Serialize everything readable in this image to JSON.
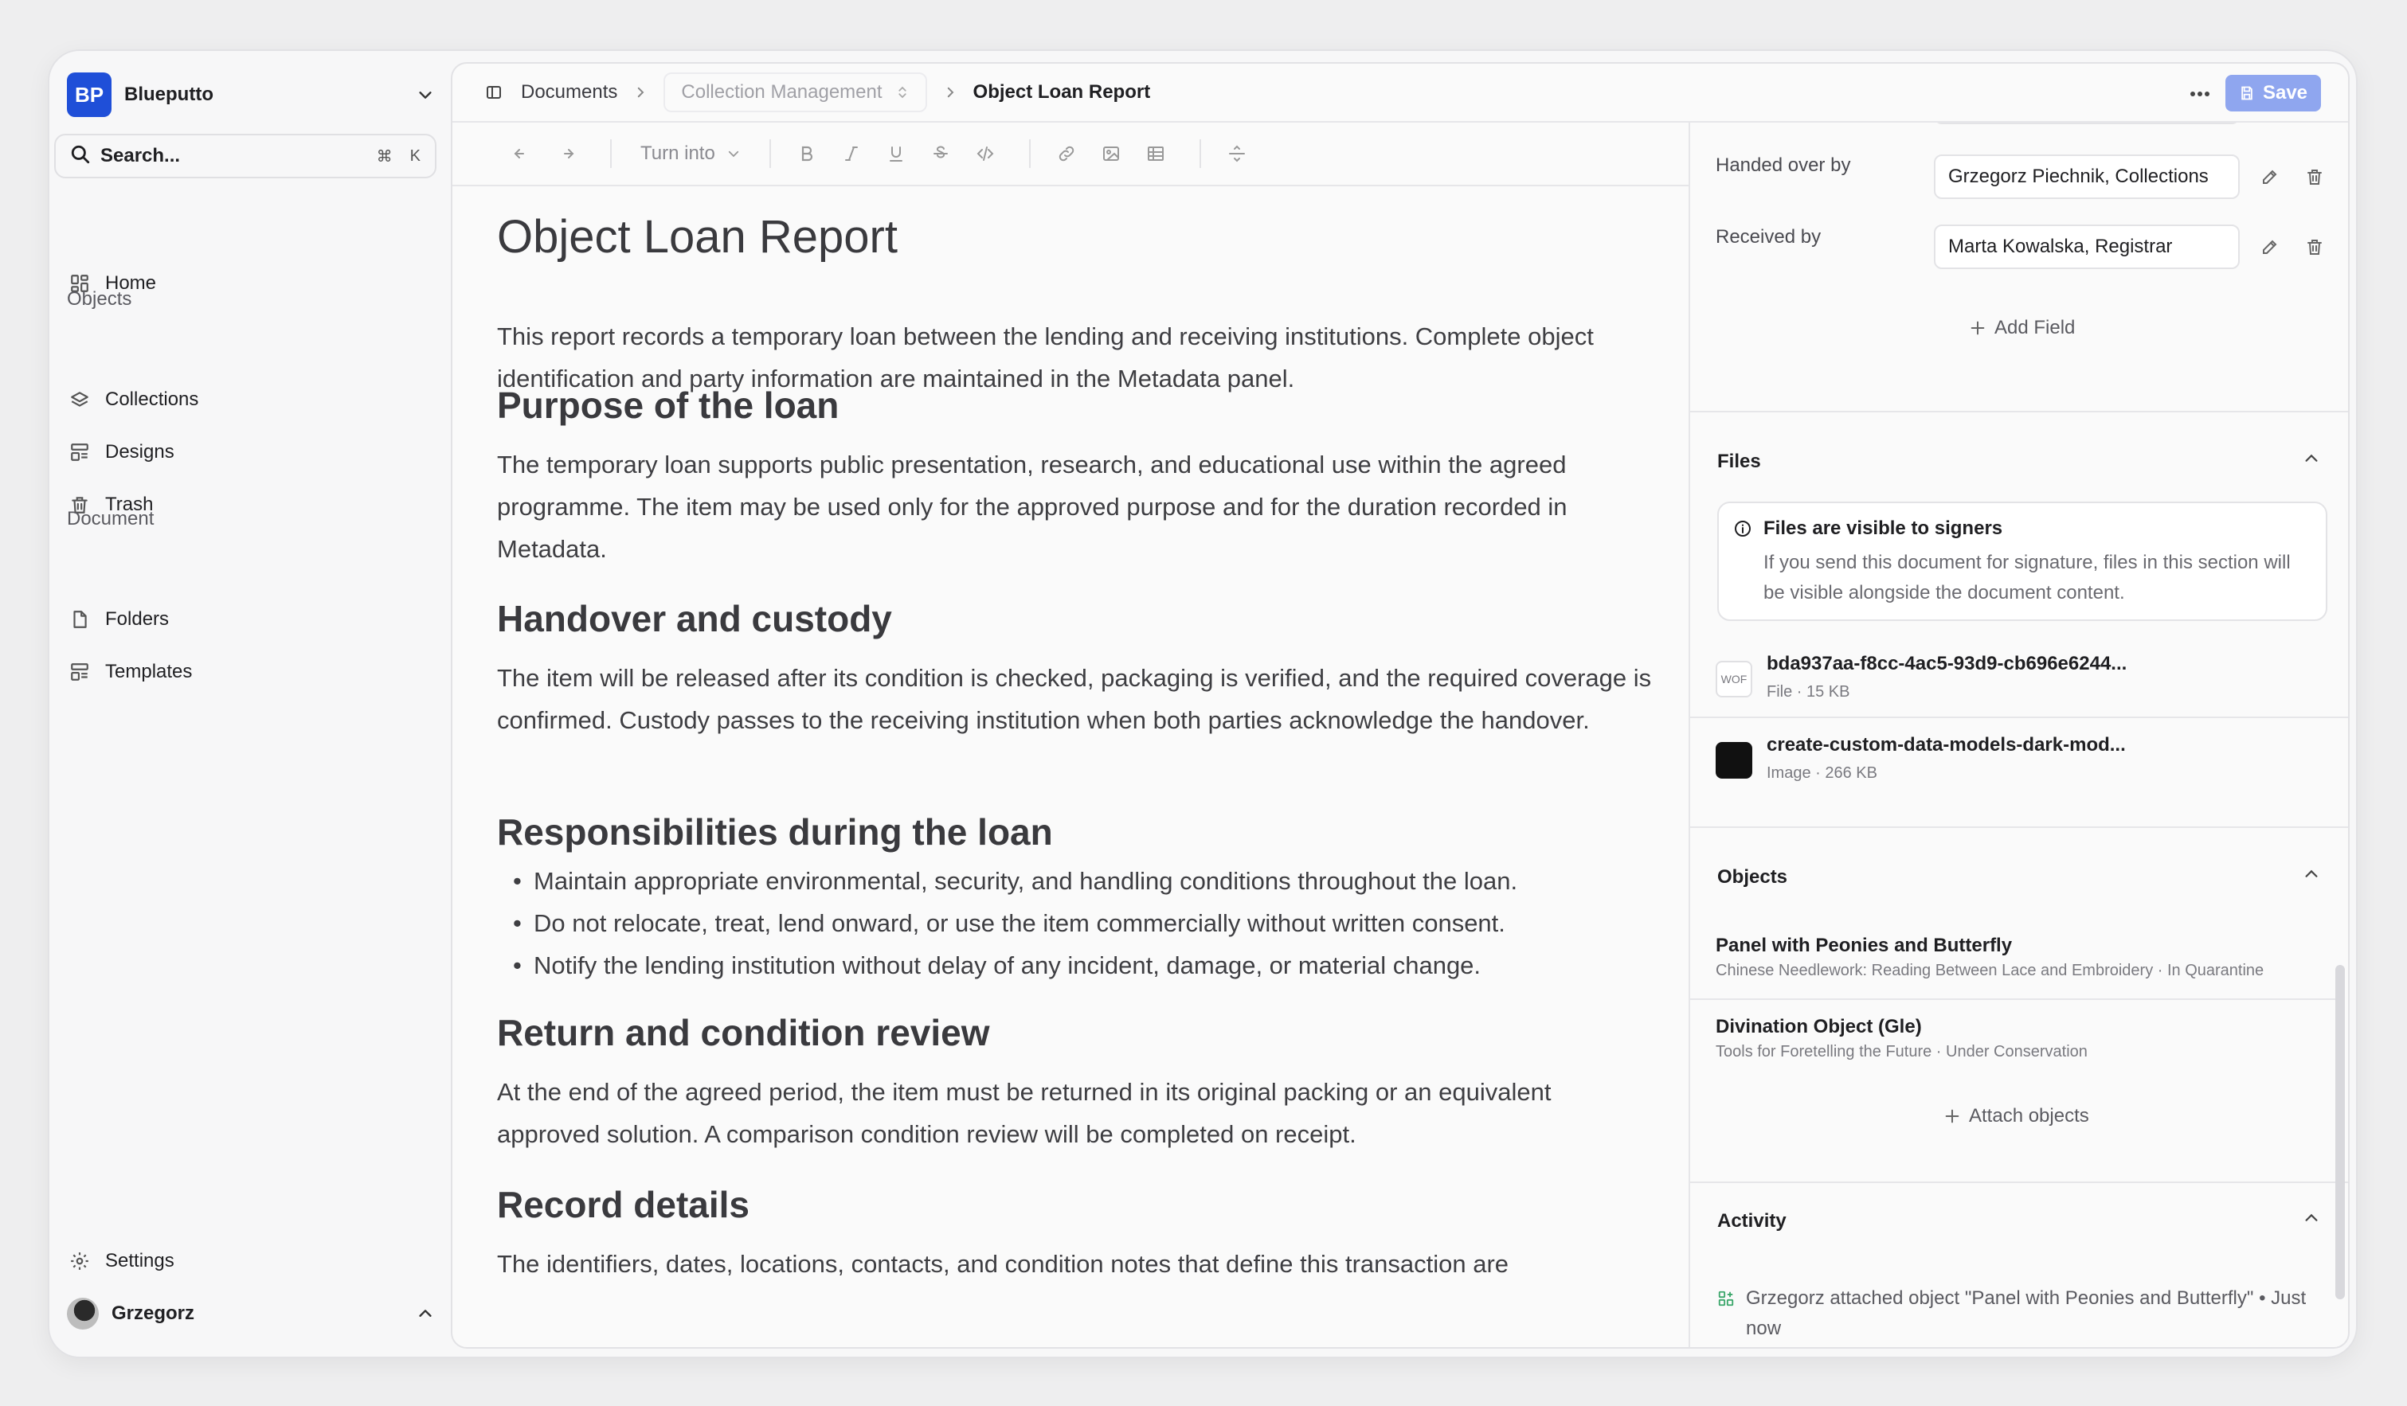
{
  "org": {
    "logo": "BP",
    "name": "Blueputto"
  },
  "search": {
    "label": "Search...",
    "kbd_cmd": "⌘",
    "kbd_key": "K"
  },
  "sidebar": {
    "home": "Home",
    "objects_section": "Objects",
    "objects_items": [
      "Collections",
      "Designs",
      "Trash"
    ],
    "document_section": "Document",
    "document_items": [
      "Folders",
      "Templates"
    ],
    "settings": "Settings",
    "user": "Grzegorz"
  },
  "breadcrumb": {
    "root": "Documents",
    "collection": "Collection Management",
    "current": "Object Loan Report"
  },
  "header": {
    "save_label": "Save"
  },
  "toolbar": {
    "turn_into": "Turn into"
  },
  "document": {
    "title": "Object Loan Report",
    "intro": "This report records a temporary loan between the lending and receiving institutions. Complete object identification and party information are maintained in the Metadata panel.",
    "h_purpose": "Purpose of the loan",
    "p_purpose": "The temporary loan supports public presentation, research, and educational use within the agreed programme. The item may be used only for the approved purpose and for the duration recorded in Metadata.",
    "h_handover": "Handover and custody",
    "p_handover": "The item will be released after its condition is checked, packaging is verified, and the required coverage is confirmed. Custody passes to the receiving institution when both parties acknowledge the handover.",
    "h_resp": "Responsibilities during the loan",
    "resp_items": [
      "Maintain appropriate environmental, security, and handling conditions throughout the loan.",
      "Do not relocate, treat, lend onward, or use the item commercially without written consent.",
      "Notify the lending institution without delay of any incident, damage, or material change."
    ],
    "h_return": "Return and condition review",
    "p_return": "At the end of the agreed period, the item must be returned in its original packing or an equivalent approved solution. A comparison condition review will be completed on receipt.",
    "h_record": "Record details",
    "p_record": "The identifiers, dates, locations, contacts, and condition notes that define this transaction are"
  },
  "metadata": {
    "handed_over_label": "Handed over by",
    "handed_over_value": "Grzegorz Piechnik, Collections",
    "received_label": "Received by",
    "received_value": "Marta Kowalska, Registrar",
    "add_field": "Add Field"
  },
  "files": {
    "title": "Files",
    "notice_title": "Files are visible to signers",
    "notice_body": "If you send this document for signature, files in this section will be visible alongside the document content.",
    "items": [
      {
        "thumb": "WOF",
        "name": "bda937aa-f8cc-4ac5-93d9-cb696e6244...",
        "meta": "File · 15 KB"
      },
      {
        "thumb": "",
        "name": "create-custom-data-models-dark-mod...",
        "meta": "Image · 266 KB"
      }
    ]
  },
  "objects": {
    "title": "Objects",
    "items": [
      {
        "name": "Panel with Peonies and Butterfly",
        "meta": "Chinese Needlework: Reading Between Lace and Embroidery · In Quarantine"
      },
      {
        "name": "Divination Object (Gle)",
        "meta": "Tools for Foretelling the Future · Under Conservation"
      }
    ],
    "attach": "Attach objects"
  },
  "activity": {
    "title": "Activity",
    "entry": "Grzegorz attached object \"Panel with Peonies and Butterfly\" • Just now"
  },
  "colors": {
    "accent": "#1f4fd8",
    "save_bg": "#8fa6ef"
  }
}
